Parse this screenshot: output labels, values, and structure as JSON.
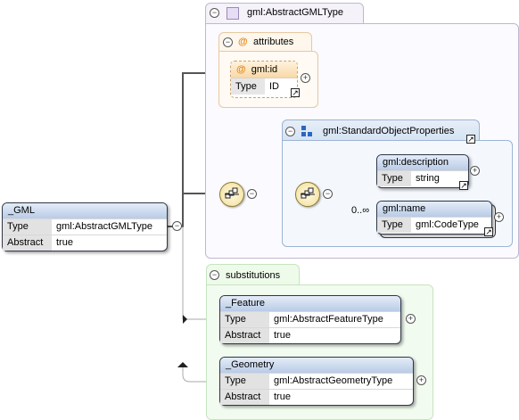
{
  "root": {
    "name": "_GML",
    "type_label": "Type",
    "type_value": "gml:AbstractGMLType",
    "abstract_label": "Abstract",
    "abstract_value": "true"
  },
  "type_group": {
    "title": "gml:AbstractGMLType",
    "toggle": "⊖"
  },
  "attributes": {
    "title": "attributes",
    "at": "@",
    "id_name": "gml:id",
    "id_type_label": "Type",
    "id_type_value": "ID"
  },
  "standard_props": {
    "title": "gml:StandardObjectProperties"
  },
  "description": {
    "name": "gml:description",
    "type_label": "Type",
    "type_value": "string"
  },
  "name_elem": {
    "name": "gml:name",
    "type_label": "Type",
    "type_value": "gml:CodeType",
    "occurs": "0..∞"
  },
  "substitutions": {
    "title": "substitutions",
    "items": [
      {
        "name": "_Feature",
        "type_label": "Type",
        "type_value": "gml:AbstractFeatureType",
        "abstract_label": "Abstract",
        "abstract_value": "true"
      },
      {
        "name": "_Geometry",
        "type_label": "Type",
        "type_value": "gml:AbstractGeometryType",
        "abstract_label": "Abstract",
        "abstract_value": "true"
      }
    ]
  },
  "glyphs": {
    "minus": "−",
    "plus": "+",
    "arrow": "↗"
  },
  "colors": {
    "type_group_border": "#c0b8d0",
    "attr_border": "#e8c8a0",
    "subst_bg": "#eefaea",
    "subst_border": "#c6e4c0",
    "element_header": "#c4d4ee"
  }
}
